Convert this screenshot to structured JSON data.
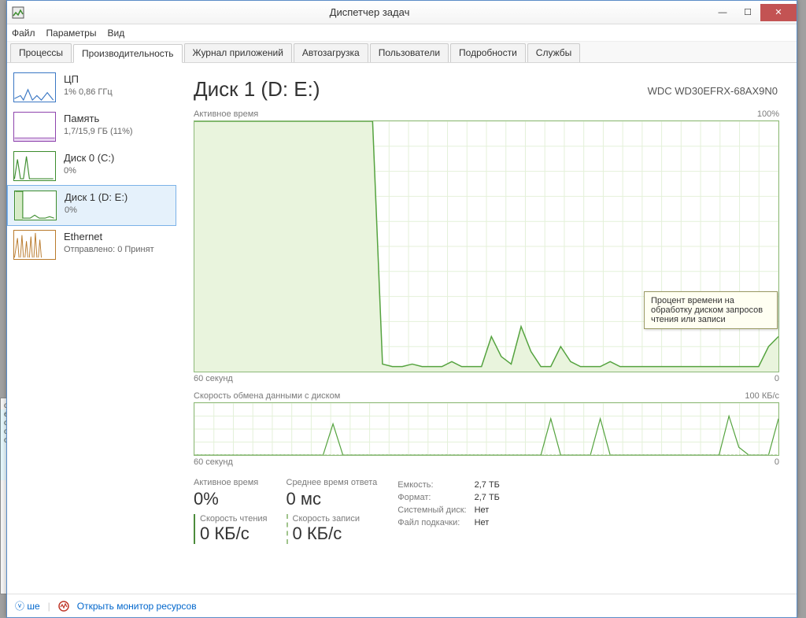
{
  "window": {
    "title": "Диспетчер задач"
  },
  "menu": {
    "file": "Файл",
    "options": "Параметры",
    "view": "Вид"
  },
  "tabs": {
    "processes": "Процессы",
    "performance": "Производительность",
    "apphistory": "Журнал приложений",
    "startup": "Автозагрузка",
    "users": "Пользователи",
    "details": "Подробности",
    "services": "Службы"
  },
  "sidebar": [
    {
      "title": "ЦП",
      "sub": "1% 0,86 ГГц",
      "color": "#3a77c4",
      "key": "cpu"
    },
    {
      "title": "Память",
      "sub": "1,7/15,9 ГБ (11%)",
      "color": "#8e44ad",
      "key": "memory"
    },
    {
      "title": "Диск 0 (C:)",
      "sub": "0%",
      "color": "#3c8c2d",
      "key": "disk0"
    },
    {
      "title": "Диск 1 (D: E:)",
      "sub": "0%",
      "color": "#3c8c2d",
      "key": "disk1",
      "selected": true
    },
    {
      "title": "Ethernet",
      "sub": "Отправлено: 0 Принят",
      "color": "#b97a2c",
      "key": "ethernet"
    }
  ],
  "main": {
    "title": "Диск 1 (D: E:)",
    "model": "WDC WD30EFRX-68AX9N0",
    "chart1": {
      "label": "Активное время",
      "ymax": "100%"
    },
    "chart2": {
      "label": "Скорость обмена данными с диском",
      "ymax": "100 КБ/с"
    },
    "xleft": "60 секунд",
    "xright": "0"
  },
  "stats": {
    "active_label": "Активное время",
    "active_value": "0%",
    "response_label": "Среднее время ответа",
    "response_value": "0 мс",
    "read_label": "Скорость чтения",
    "read_value": "0 КБ/с",
    "write_label": "Скорость записи",
    "write_value": "0 КБ/с"
  },
  "info": {
    "capacity_label": "Емкость:",
    "capacity_value": "2,7 ТБ",
    "formatted_label": "Формат:",
    "formatted_value": "2,7 ТБ",
    "system_label": "Системный диск:",
    "system_value": "Нет",
    "pagefile_label": "Файл подкачки:",
    "pagefile_value": "Нет"
  },
  "tooltip": "Процент времени на обработку диском запросов чтения или записи",
  "footer": {
    "fewer": "ше",
    "open_monitor": "Открыть монитор ресурсов"
  },
  "chart_data": [
    {
      "type": "area",
      "title": "Активное время",
      "ylabel": "%",
      "ylim": [
        0,
        100
      ],
      "xlabel": "секунд",
      "xlim": [
        60,
        0
      ],
      "values_pct": [
        100,
        100,
        100,
        100,
        100,
        100,
        100,
        100,
        100,
        100,
        100,
        100,
        100,
        100,
        100,
        100,
        100,
        100,
        100,
        3,
        2,
        2,
        3,
        2,
        2,
        2,
        4,
        2,
        2,
        2,
        14,
        6,
        3,
        18,
        8,
        2,
        2,
        10,
        4,
        2,
        2,
        2,
        4,
        2,
        2,
        2,
        2,
        2,
        2,
        2,
        2,
        2,
        2,
        2,
        2,
        2,
        2,
        2,
        10,
        14
      ]
    },
    {
      "type": "line",
      "title": "Скорость обмена данными с диском",
      "ylabel": "КБ/с",
      "ylim": [
        0,
        100
      ],
      "xlabel": "секунд",
      "xlim": [
        60,
        0
      ],
      "series": [
        {
          "name": "Чтение",
          "values": [
            0,
            0,
            0,
            0,
            0,
            0,
            0,
            0,
            0,
            0,
            0,
            0,
            0,
            0,
            60,
            0,
            0,
            0,
            0,
            0,
            0,
            0,
            0,
            0,
            0,
            0,
            0,
            0,
            0,
            0,
            0,
            0,
            0,
            0,
            0,
            0,
            70,
            0,
            0,
            0,
            0,
            70,
            0,
            0,
            0,
            0,
            0,
            0,
            0,
            0,
            0,
            0,
            0,
            0,
            75,
            15,
            0,
            0,
            0,
            70
          ]
        },
        {
          "name": "Запись",
          "values": [
            0,
            0,
            0,
            0,
            0,
            0,
            0,
            0,
            0,
            0,
            0,
            0,
            0,
            0,
            0,
            0,
            0,
            0,
            0,
            0,
            0,
            0,
            0,
            0,
            0,
            0,
            0,
            0,
            0,
            0,
            0,
            0,
            0,
            0,
            0,
            0,
            0,
            0,
            0,
            0,
            0,
            0,
            0,
            0,
            0,
            0,
            0,
            0,
            0,
            0,
            0,
            0,
            0,
            0,
            0,
            0,
            0,
            0,
            0,
            0
          ]
        }
      ]
    }
  ]
}
